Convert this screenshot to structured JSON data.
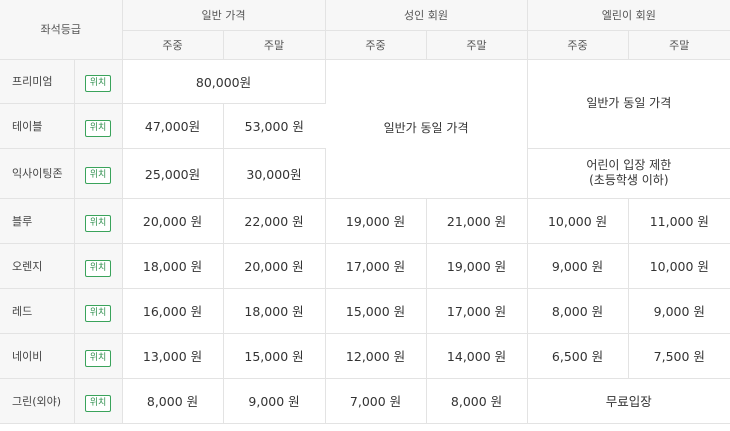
{
  "headers": {
    "seat_grade": "좌석등급",
    "groups": [
      "일반 가격",
      "성인 회원",
      "엘린이 회원"
    ],
    "weekday": "주중",
    "weekend": "주말"
  },
  "location_label": "위치",
  "rows": [
    {
      "grade": "프리미엄",
      "general": "80,000원"
    },
    {
      "grade": "테이블",
      "general_weekday": "47,000원",
      "general_weekend": "53,000 원"
    },
    {
      "grade": "익사이팅존",
      "general_weekday": "25,000원",
      "general_weekend": "30,000원"
    },
    {
      "grade": "블루",
      "prices": [
        "20,000 원",
        "22,000 원",
        "19,000 원",
        "21,000 원",
        "10,000 원",
        "11,000 원"
      ]
    },
    {
      "grade": "오렌지",
      "prices": [
        "18,000 원",
        "20,000 원",
        "17,000 원",
        "19,000 원",
        "9,000 원",
        "10,000 원"
      ]
    },
    {
      "grade": "레드",
      "prices": [
        "16,000 원",
        "18,000 원",
        "15,000 원",
        "17,000 원",
        "8,000 원",
        "9,000 원"
      ]
    },
    {
      "grade": "네이비",
      "prices": [
        "13,000 원",
        "15,000 원",
        "12,000 원",
        "14,000 원",
        "6,500 원",
        "7,500 원"
      ]
    },
    {
      "grade": "그린(외야)",
      "prices": [
        "8,000 원",
        "9,000 원",
        "7,000 원",
        "8,000 원"
      ],
      "kids": "무료입장"
    }
  ],
  "notes": {
    "same_as_general_adult": "일반가 동일 가격",
    "same_as_general_kids": "일반가 동일 가격",
    "kids_restricted_line1": "어린이 입장 제한",
    "kids_restricted_line2": "(초등학생 이하)"
  }
}
